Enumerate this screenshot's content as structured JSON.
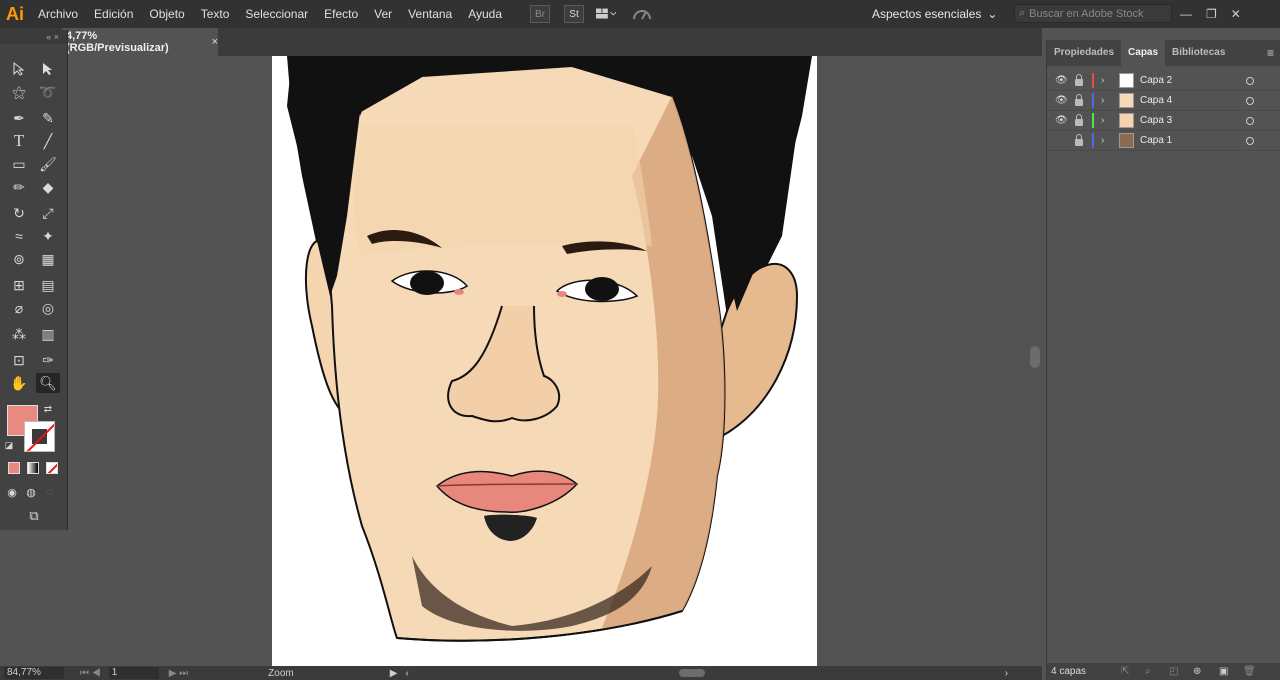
{
  "app": {
    "logo": "Ai"
  },
  "menu": [
    "Archivo",
    "Edición",
    "Objeto",
    "Texto",
    "Seleccionar",
    "Efecto",
    "Ver",
    "Ventana",
    "Ayuda"
  ],
  "menubar_icons": [
    "Br",
    "St"
  ],
  "workspace": {
    "label": "Aspectos esenciales"
  },
  "search": {
    "placeholder": "Buscar en Adobe Stock"
  },
  "document_tab": {
    "title": "4,77% (RGB/Previsualizar)",
    "close": "×"
  },
  "panel": {
    "tabs": [
      "Propiedades",
      "Capas",
      "Bibliotecas"
    ],
    "active_tab": "Capas",
    "layers": [
      {
        "name": "Capa 2",
        "visible": true,
        "color": "#e84a4a"
      },
      {
        "name": "Capa 4",
        "visible": true,
        "color": "#4a6ae8"
      },
      {
        "name": "Capa 3",
        "visible": true,
        "color": "#4ae84a"
      },
      {
        "name": "Capa 1",
        "visible": false,
        "color": "#4a6ae8"
      }
    ],
    "footer": "4 capas"
  },
  "status": {
    "zoom": "84,77%",
    "artboard": "1",
    "tool": "Zoom"
  },
  "colors": {
    "fill": "#e98a80",
    "stroke": "none",
    "skin": "#f5d5b0",
    "hair": "#111111",
    "lips": "#e8877c"
  }
}
